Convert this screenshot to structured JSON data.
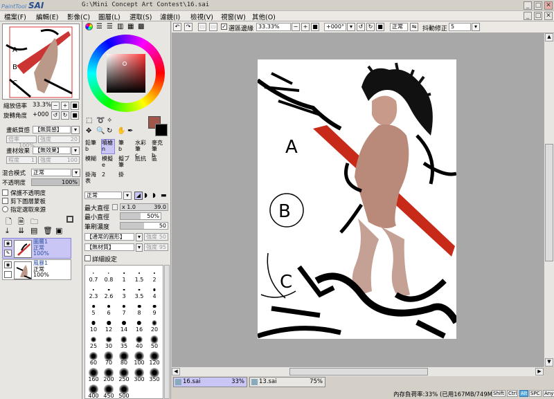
{
  "app": {
    "logo_small": "PaintTool",
    "logo_big": "SAI",
    "window_title": "G:\\Mini Concept Art Contest\\16.sai"
  },
  "menu": [
    "檔案(F)",
    "編輯(E)",
    "影像(C)",
    "圖層(L)",
    "選取(S)",
    "濾鏡(I)",
    "檢視(V)",
    "視窗(W)",
    "其他(O)"
  ],
  "navigator": {
    "zoom_label": "縮放倍率",
    "zoom_value": "33.3%",
    "rotate_label": "旋轉角度",
    "rotate_value": "+000",
    "zoom_minus": "−",
    "zoom_plus": "+",
    "zoom_reset": "■",
    "rotate_ccw": "↺",
    "rotate_cw": "↻",
    "rotate_reset": "■"
  },
  "paper": {
    "texture_label": "畫紙質感",
    "texture_value": "【無質感】",
    "texture_rate_label": "倍率",
    "texture_rate_value": "100%",
    "texture_strength_label": "強度",
    "texture_strength_value": "20",
    "effect_label": "畫材效果",
    "effect_value": "【無效果】",
    "effect_degree_label": "程度",
    "effect_degree_value": "1",
    "effect_strength_label": "強度",
    "effect_strength_value": "100"
  },
  "blend": {
    "mode_label": "混合模式",
    "mode_value": "正常",
    "opacity_label": "不透明度",
    "opacity_value": "100%",
    "opacity_fraction": 1.0,
    "preserve_opacity": "保護不透明度",
    "clip_group": "剪下圖層蒙板",
    "selection_source": "指定選取來源"
  },
  "layers": [
    {
      "name": "圖層1",
      "mode": "正常",
      "opacity": "100%",
      "selected": true
    },
    {
      "name": "風暴1",
      "mode": "正常",
      "opacity": "100%",
      "selected": false
    }
  ],
  "color": {
    "current": "#a0564a",
    "secondary": "#000000",
    "accent_selected": "#c9c6f6"
  },
  "tools_row1": [
    {
      "label": "鉛筆",
      "sub": "b"
    },
    {
      "label": "噴槍",
      "sub": "n"
    },
    {
      "label": "筆",
      "sub": "b"
    },
    {
      "label": "水彩筆",
      "sub": "c"
    },
    {
      "label": "麥克筆",
      "sub": "b"
    }
  ],
  "tools_row2": [
    {
      "label": "模糊",
      "sub": ""
    },
    {
      "label": "模擬",
      "sub": "e"
    },
    {
      "label": "擬ブ筆",
      "sub": ""
    },
    {
      "label": "抵抗",
      "sub": ""
    },
    {
      "label": "區",
      "sub": ""
    }
  ],
  "tools_row3": [
    {
      "label": "掛海表",
      "sub": ""
    },
    {
      "label": "2",
      "sub": ""
    },
    {
      "label": "掛",
      "sub": ""
    }
  ],
  "brush_settings": {
    "mode_value": "正常",
    "max_size_label": "最大直徑",
    "max_size_mult": "x 1.0",
    "max_size_value": "39.0",
    "min_size_label": "最小直徑",
    "min_size_value": "50%",
    "density_label": "筆刷濃度",
    "density_value": "50",
    "shape_value": "【通常的圓形】",
    "shape_strength_label": "強度",
    "shape_strength_value": "50",
    "texture_value": "【無材質】",
    "texture_strength_label": "強度",
    "texture_strength_value": "95",
    "detail_label": "詳細設定"
  },
  "brush_sizes": [
    "0.7",
    "0.8",
    "1",
    "1.5",
    "2",
    "2.3",
    "2.6",
    "3",
    "3.5",
    "4",
    "5",
    "6",
    "7",
    "8",
    "9",
    "10",
    "12",
    "14",
    "16",
    "20",
    "25",
    "30",
    "35",
    "40",
    "50",
    "60",
    "70",
    "80",
    "100",
    "120",
    "160",
    "200",
    "250",
    "300",
    "350",
    "400",
    "450",
    "500"
  ],
  "topbar": {
    "selection_edge_label": "選區邊緣",
    "zoom_value": "33.33%",
    "rotation_value": "+000°",
    "blend_value": "正常",
    "stabilizer_label": "抖動修正",
    "stabilizer_value": "5"
  },
  "file_tabs": [
    {
      "name": "16.sai",
      "zoom": "33%",
      "active": true
    },
    {
      "name": "13.sai",
      "zoom": "75%",
      "active": false
    }
  ],
  "status": {
    "memory_text": "內存負荷率:33% (已用167MB/749MB)",
    "keys": [
      "Shift",
      "Ctrl",
      "Alt",
      "SPC",
      "Any"
    ]
  }
}
